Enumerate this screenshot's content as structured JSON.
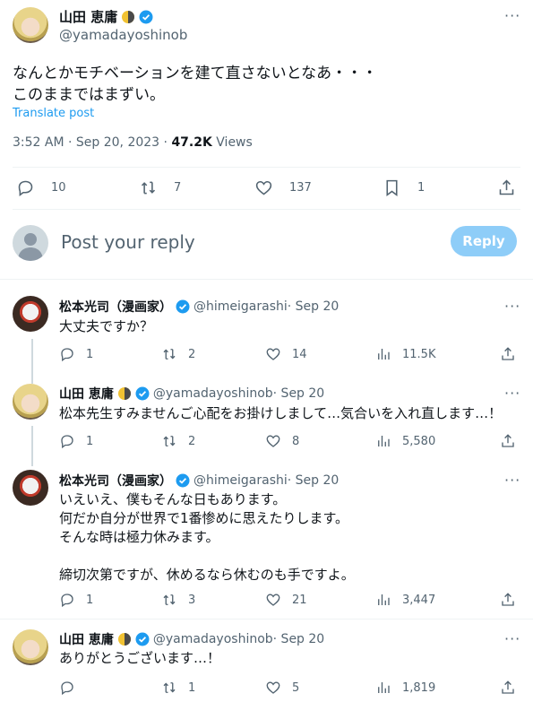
{
  "colors": {
    "accent": "#1d9bf0",
    "reply_button": "#8ecdf8",
    "muted": "#536471"
  },
  "main_post": {
    "author_name": "山田 恵庸",
    "handle": "@yamadayoshinob",
    "text": "なんとかモチベーションを建て直さないとなあ・・・\nこのままではまずい。",
    "translate": "Translate post",
    "time": "3:52 AM · Sep 20, 2023 · ",
    "views_count": "47.2K",
    "views_label": " Views",
    "replies": "10",
    "reposts": "7",
    "likes": "137",
    "bookmarks": "1"
  },
  "composer": {
    "placeholder": "Post your reply",
    "button": "Reply"
  },
  "replies": [
    {
      "name": "松本光司（漫画家）",
      "handle": "@himeigarashi",
      "date": " · Sep 20",
      "text": "大丈夫ですか？",
      "replies": "1",
      "reposts": "2",
      "likes": "14",
      "views": "11.5K",
      "avatar": "matsumoto"
    },
    {
      "name": "山田 恵庸",
      "handle": "@yamadayoshinob",
      "date": " · Sep 20",
      "text": "松本先生すみませんご心配をお掛けしまして…気合いを入れ直します…！",
      "replies": "1",
      "reposts": "2",
      "likes": "8",
      "views": "5,580",
      "avatar": "yamada"
    },
    {
      "name": "松本光司（漫画家）",
      "handle": "@himeigarashi",
      "date": " · Sep 20",
      "text": "いえいえ、僕もそんな日もあります。\n何だか自分が世界で1番惨めに思えたりします。\nそんな時は極力休みます。\n\n締切次第ですが、休めるなら休むのも手ですよ。",
      "replies": "1",
      "reposts": "3",
      "likes": "21",
      "views": "3,447",
      "avatar": "matsumoto"
    },
    {
      "name": "山田 恵庸",
      "handle": "@yamadayoshinob",
      "date": " · Sep 20",
      "text": "ありがとうございます…！",
      "replies": "",
      "reposts": "1",
      "likes": "5",
      "views": "1,819",
      "avatar": "yamada"
    }
  ]
}
